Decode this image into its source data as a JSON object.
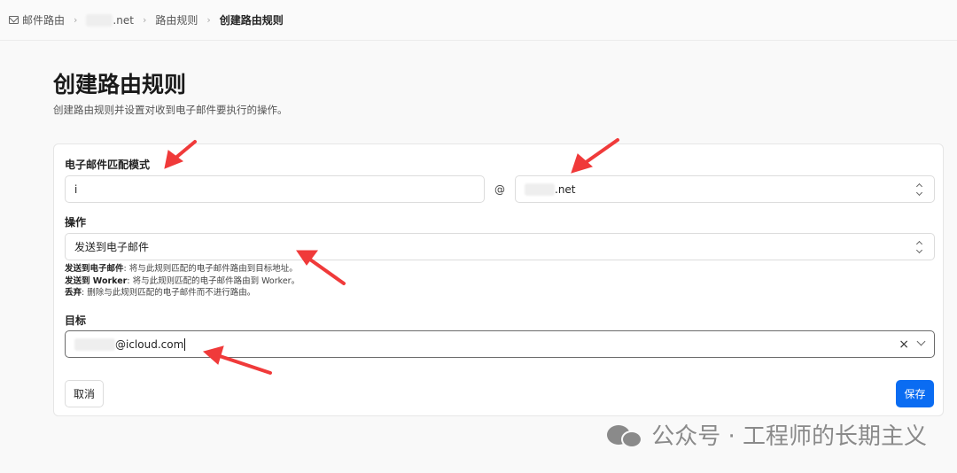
{
  "breadcrumb": {
    "root": "邮件路由",
    "domain_suffix": ".net",
    "rules": "路由规则",
    "current": "创建路由规则"
  },
  "page": {
    "title": "创建路由规则",
    "subtitle": "创建路由规则并设置对收到电子邮件要执行的操作。"
  },
  "form": {
    "pattern_label": "电子邮件匹配模式",
    "pattern_value": "i",
    "at_symbol": "@",
    "domain_value": ".net",
    "action_label": "操作",
    "action_value": "发送到电子邮件",
    "help": [
      {
        "term": "发送到电子邮件",
        "desc": ": 将与此规则匹配的电子邮件路由到目标地址。"
      },
      {
        "term": "发送到 Worker",
        "desc": ": 将与此规则匹配的电子邮件路由到 Worker。"
      },
      {
        "term": "丢弃",
        "desc": ": 删除与此规则匹配的电子邮件而不进行路由。"
      }
    ],
    "target_label": "目标",
    "target_value": "@icloud.com",
    "clear_symbol": "×"
  },
  "buttons": {
    "cancel": "取消",
    "save": "保存"
  },
  "watermark": "公众号 · 工程师的长期主义",
  "colors": {
    "accent": "#0a6cf2",
    "annotation_arrow": "#f03a3a"
  }
}
